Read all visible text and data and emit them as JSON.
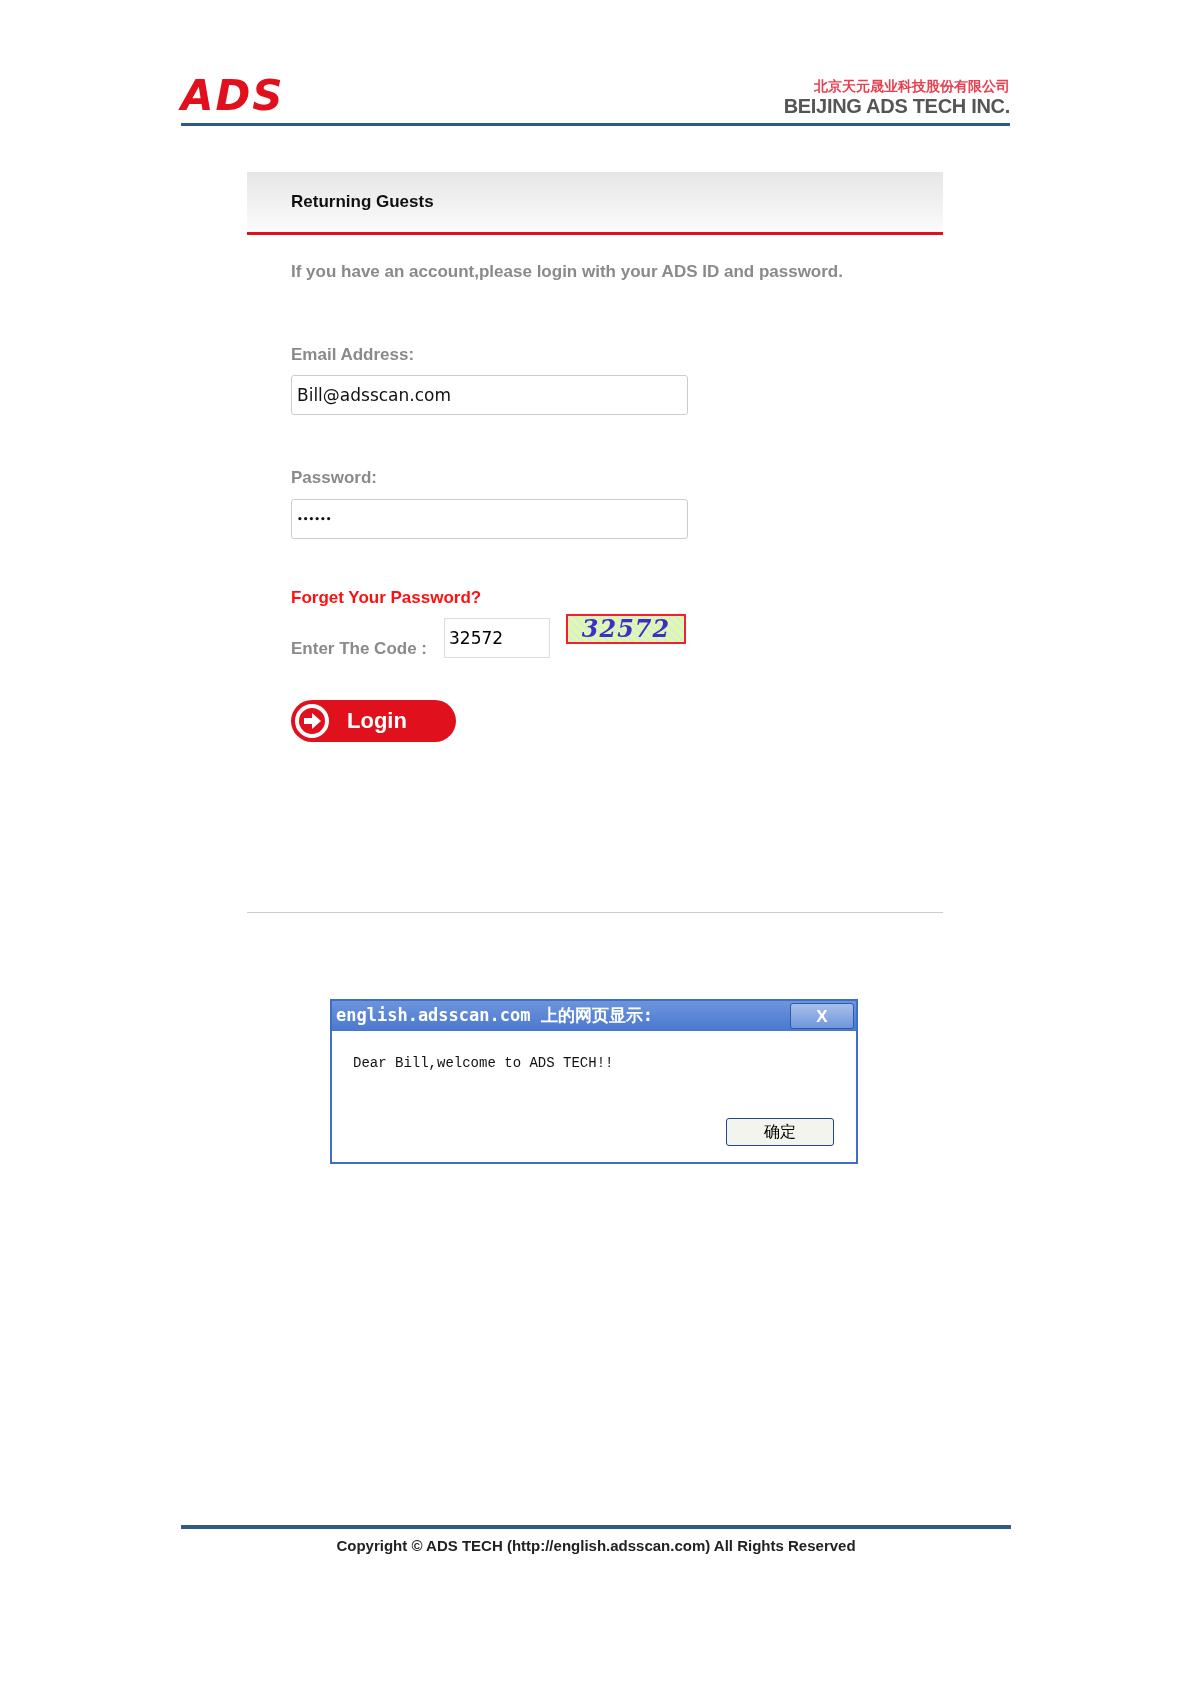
{
  "header": {
    "logo": "ADS",
    "company_cn": "北京天元晟业科技股份有限公司",
    "company_en": "BEIJING ADS TECH INC."
  },
  "login_panel": {
    "title": "Returning Guests",
    "intro": "If you have an account,please login with your ADS ID and password.",
    "email": {
      "label": "Email Address:",
      "value": "Bill@adsscan.com"
    },
    "password": {
      "label": "Password:",
      "value": "••••••"
    },
    "forgot_link": "Forget Your Password?",
    "code": {
      "label": "Enter The Code :",
      "value": "32572",
      "captcha": "32572"
    },
    "login_button": "Login"
  },
  "dialog": {
    "title": "english.adsscan.com 上的网页显示:",
    "close": "X",
    "message": "Dear Bill,welcome to ADS TECH!!",
    "ok_button": "确定"
  },
  "footer": {
    "copyright": "Copyright © ADS TECH (http://english.adsscan.com) All Rights Reserved"
  }
}
